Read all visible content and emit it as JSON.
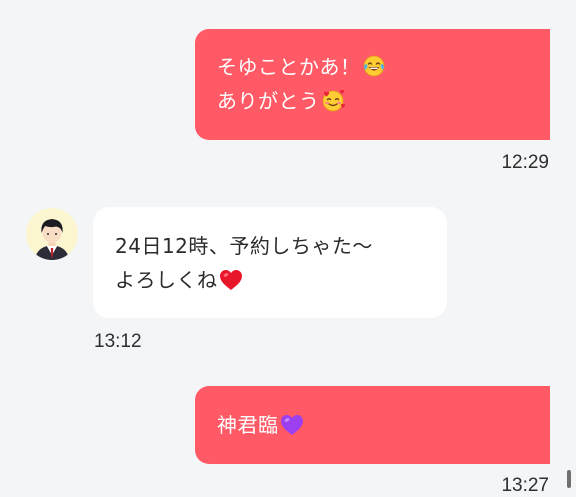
{
  "messages": [
    {
      "direction": "outgoing",
      "lines": [
        "そゆことかあ！",
        "ありがとう"
      ],
      "emojis": [
        "face-with-tears-of-joy-emoji",
        "smiling-face-with-hearts-emoji"
      ],
      "time": "12:29"
    },
    {
      "direction": "incoming",
      "lines": [
        "24日12時、予約しちゃた〜",
        "よろしくね"
      ],
      "emojis": [
        "red-heart-emoji"
      ],
      "time": "13:12"
    },
    {
      "direction": "outgoing",
      "lines": [
        "神君臨"
      ],
      "emojis": [
        "purple-heart-emoji"
      ],
      "time": "13:27"
    }
  ],
  "colors": {
    "background": "#f4f5f7",
    "outgoing_bubble": "#ff5a66",
    "outgoing_text": "#ffffff",
    "incoming_bubble": "#ffffff",
    "incoming_text": "#2b2b2b",
    "avatar_background": "#fbf6cf"
  },
  "icons": {
    "avatar": "person-in-suit-avatar-icon"
  }
}
